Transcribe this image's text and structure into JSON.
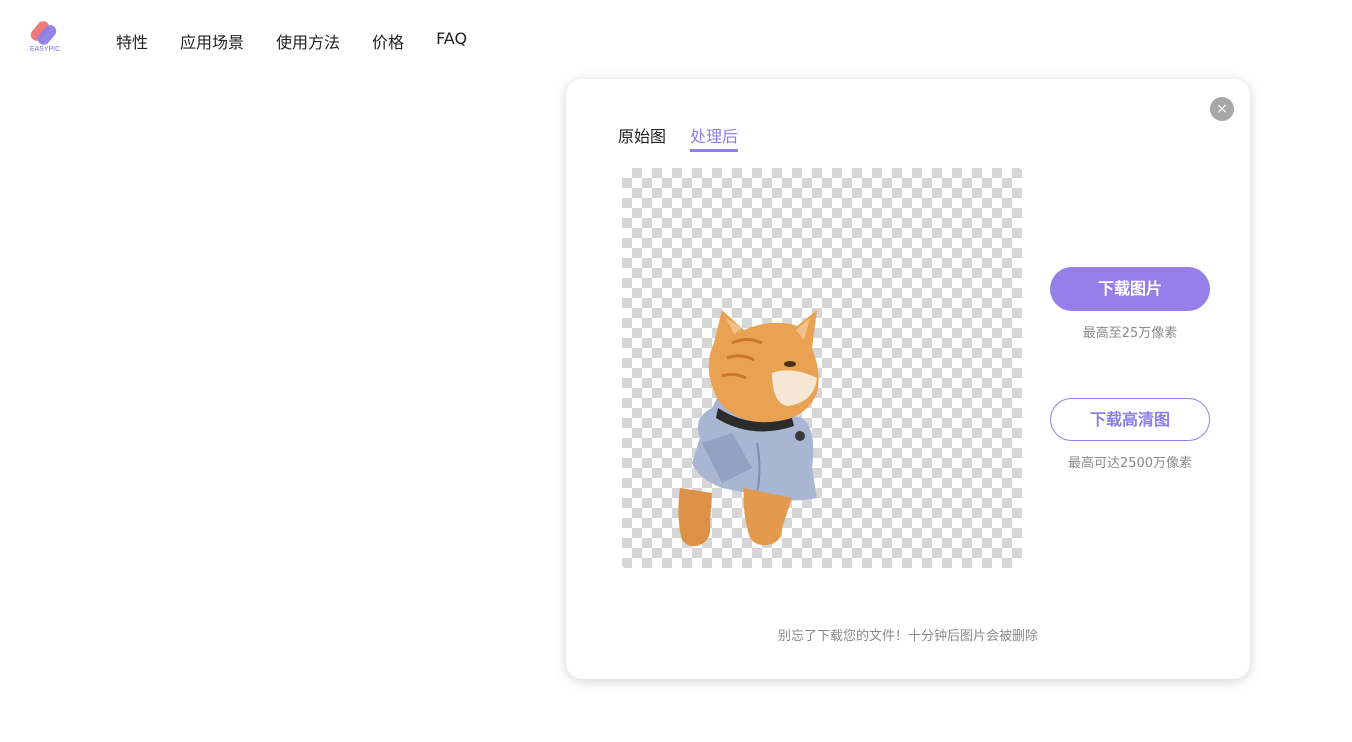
{
  "brand": {
    "logo_text": "EASYPIC",
    "colors": {
      "accent": "#9580ea",
      "logo_red": "#f07a7a",
      "logo_purple": "#8d7fe8"
    }
  },
  "nav": {
    "items": [
      {
        "label": "特性"
      },
      {
        "label": "应用场景"
      },
      {
        "label": "使用方法"
      },
      {
        "label": "价格"
      },
      {
        "label": "FAQ"
      }
    ]
  },
  "modal": {
    "close_icon": "×",
    "tabs": [
      {
        "label": "原始图",
        "active": false
      },
      {
        "label": "处理后",
        "active": true
      }
    ],
    "preview": {
      "icon": "transparent-checkerboard",
      "subject": "orange cat in gray-blue vest"
    },
    "download": {
      "primary_label": "下载图片",
      "primary_note": "最高至25万像素",
      "hd_label": "下载高清图",
      "hd_note": "最高可达2500万像素"
    },
    "footer_note": "别忘了下载您的文件！十分钟后图片会被删除"
  }
}
